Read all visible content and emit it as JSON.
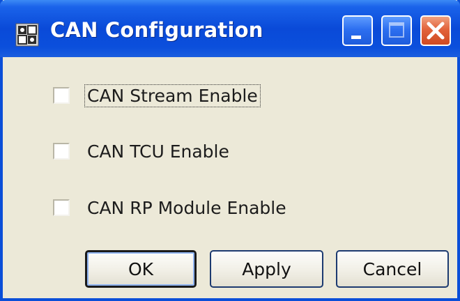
{
  "window": {
    "title": "CAN Configuration",
    "app_icon": "can-config-icon",
    "controls": {
      "minimize_icon": "minimize-icon",
      "maximize_icon": "maximize-icon",
      "close_icon": "close-icon"
    }
  },
  "options": [
    {
      "label": "CAN Stream Enable",
      "checked": false,
      "focused": true
    },
    {
      "label": "CAN TCU Enable",
      "checked": false,
      "focused": false
    },
    {
      "label": "CAN RP Module Enable",
      "checked": false,
      "focused": false
    }
  ],
  "buttons": {
    "ok_label": "OK",
    "apply_label": "Apply",
    "cancel_label": "Cancel"
  },
  "colors": {
    "titlebar": "#0a4ad8",
    "dialog_background": "#ece9d8",
    "close_button": "#e2633b"
  }
}
